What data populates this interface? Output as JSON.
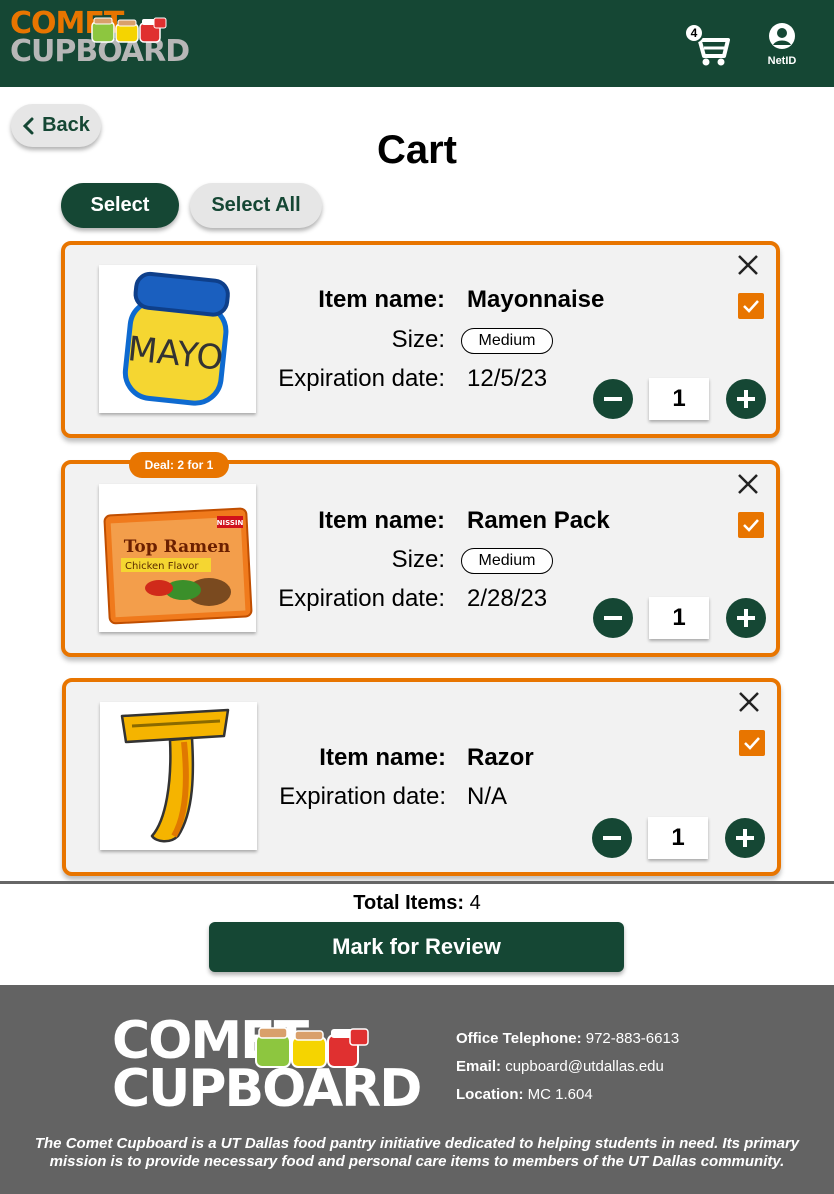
{
  "header": {
    "logo_line1": "COMET",
    "logo_line2": "CUPBOARD",
    "cart_count": "4",
    "netid_label": "NetID"
  },
  "nav": {
    "back_label": "Back"
  },
  "page_title": "Cart",
  "actions": {
    "select_label": "Select",
    "select_all_label": "Select All"
  },
  "labels": {
    "item_name": "Item name:",
    "size": "Size:",
    "expiration": "Expiration date:"
  },
  "items": [
    {
      "name": "Mayonnaise",
      "size": "Medium",
      "expiration": "12/5/23",
      "quantity": "1",
      "checked": true,
      "image_icon": "mayo-jar-icon"
    },
    {
      "name": "Ramen Pack",
      "size": "Medium",
      "expiration": "2/28/23",
      "quantity": "1",
      "checked": true,
      "deal": "Deal: 2 for 1",
      "image_icon": "ramen-pack-icon",
      "package_brand": "Top Ramen",
      "package_flavor": "Chicken Flavor",
      "package_maker": "NISSIN"
    },
    {
      "name": "Razor",
      "expiration": "N/A",
      "quantity": "1",
      "checked": true,
      "image_icon": "razor-icon"
    }
  ],
  "summary": {
    "total_label": "Total Items:",
    "total_value": "4",
    "review_button": "Mark for Review"
  },
  "footer": {
    "logo_line1": "COMET",
    "logo_line2": "CUPBOARD",
    "phone_label": "Office Telephone:",
    "phone": "972-883-6613",
    "email_label": "Email:",
    "email": "cupboard@utdallas.edu",
    "location_label": "Location:",
    "location": "MC 1.604",
    "about": "The Comet Cupboard is a UT Dallas food pantry initiative dedicated to helping students in need. Its primary mission is to provide necessary food and personal care items to members of the UT Dallas community."
  },
  "colors": {
    "brand_green": "#154734",
    "accent_orange": "#e87500",
    "footer_gray": "#636363"
  }
}
